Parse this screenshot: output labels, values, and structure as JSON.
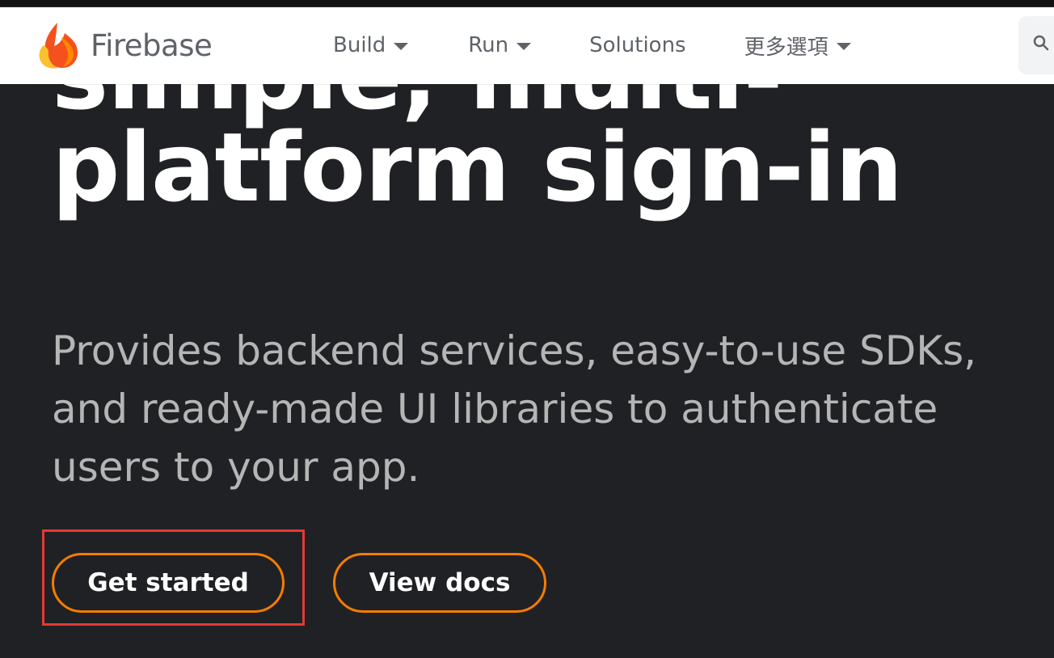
{
  "header": {
    "brand": "Firebase",
    "nav": [
      {
        "label": "Build"
      },
      {
        "label": "Run"
      },
      {
        "label": "Solutions"
      },
      {
        "label": "更多選項"
      }
    ]
  },
  "hero": {
    "title_line1": "simple, multi-",
    "title_line2": "platform sign-in",
    "description": "Provides backend services, easy-to-use SDKs, and ready-made UI libraries to authenticate users to your app."
  },
  "actions": {
    "primary_label": "Get started",
    "secondary_label": "View docs"
  },
  "colors": {
    "accent": "#f57c00",
    "highlight": "#e53935",
    "background": "#202124"
  },
  "icons": {
    "logo": "firebase-flame-icon",
    "dropdown": "caret-down-icon",
    "search": "search-icon"
  }
}
